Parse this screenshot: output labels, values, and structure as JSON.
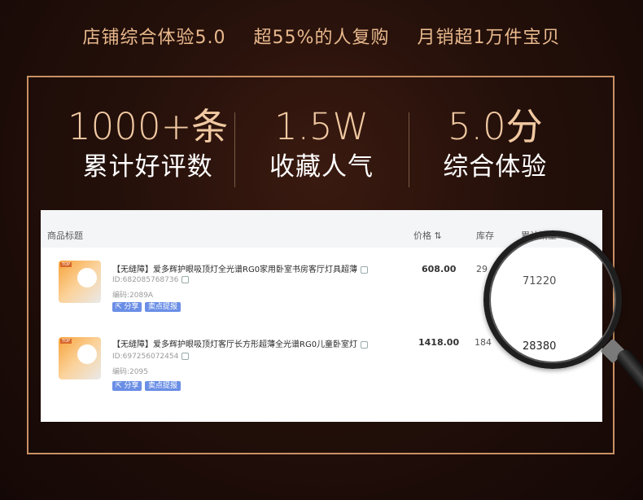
{
  "banner": {
    "items": [
      "店铺综合体验5.0",
      "超55%的人复购",
      "月销超1万件宝贝"
    ]
  },
  "stats": [
    {
      "value": "1000+条",
      "label": "累计好评数"
    },
    {
      "value": "1.5W",
      "label": "收藏人气"
    },
    {
      "value": "5.0分",
      "label": "综合体验"
    }
  ],
  "table": {
    "headers": {
      "title": "商品标题",
      "price": "价格",
      "stock": "库存",
      "sales": "累计销量"
    },
    "rows": [
      {
        "thumb_tag": "TOP",
        "title": "【无缝障】爱多辉护眼吸顶灯全光谱RG0家用卧室书房客厅灯具超薄",
        "id": "ID:682085768736",
        "code": "编码:2089A",
        "share": "分享",
        "tip": "卖点提报",
        "price": "608.00",
        "stock": "29",
        "sales": "71220"
      },
      {
        "thumb_tag": "TOP",
        "title": "【无缝障】爱多辉护眼吸顶灯客厅长方形超薄全光谱RG0儿童卧室灯",
        "id": "ID:697256072454",
        "code": "编码:2095",
        "share": "分享",
        "tip": "卖点提报",
        "price": "1418.00",
        "stock": "184",
        "sales": "28380"
      }
    ]
  },
  "colors": {
    "accent": "#e9b98d",
    "frame": "#c99064",
    "badge": "#6b8fe6"
  }
}
